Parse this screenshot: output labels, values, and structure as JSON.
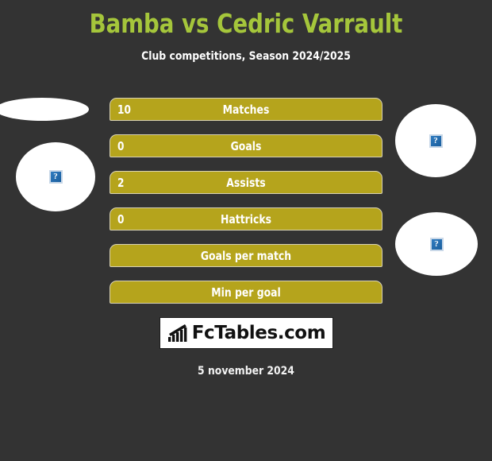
{
  "header": {
    "title": "Bamba vs Cedric Varrault",
    "subtitle": "Club competitions, Season 2024/2025",
    "title_color": "#a5c63b"
  },
  "comparison": {
    "player_left": "Bamba",
    "player_right": "Cedric Varrault",
    "bar_color": "#b5a41c",
    "rows": [
      {
        "value": "10",
        "label": "Matches"
      },
      {
        "value": "0",
        "label": "Goals"
      },
      {
        "value": "2",
        "label": "Assists"
      },
      {
        "value": "0",
        "label": "Hattricks"
      },
      {
        "value": "",
        "label": "Goals per match"
      },
      {
        "value": "",
        "label": "Min per goal"
      }
    ]
  },
  "photos": [
    {
      "name": "left-top",
      "icon": "broken-image-icon"
    },
    {
      "name": "left-main",
      "icon": "broken-image-icon"
    },
    {
      "name": "right-top",
      "icon": "broken-image-icon"
    },
    {
      "name": "right-main",
      "icon": "broken-image-icon"
    }
  ],
  "footer": {
    "logo_text": "FcTables.com",
    "logo_icon": "bar-chart-growth-icon",
    "date": "5 november 2024"
  },
  "chart_data": {
    "type": "bar",
    "title": "Bamba vs Cedric Varrault",
    "subtitle": "Club competitions, Season 2024/2025",
    "categories": [
      "Matches",
      "Goals",
      "Assists",
      "Hattricks",
      "Goals per match",
      "Min per goal"
    ],
    "series": [
      {
        "name": "Bamba",
        "values": [
          10,
          0,
          2,
          0,
          null,
          null
        ]
      }
    ],
    "xlabel": "",
    "ylabel": "",
    "grid": false,
    "legend": "none"
  }
}
